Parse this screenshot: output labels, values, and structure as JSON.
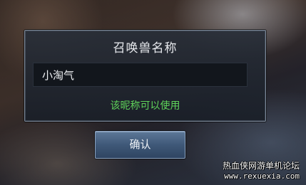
{
  "dialog": {
    "title": "召唤兽名称",
    "input_value": "小淘气",
    "status": "该昵称可以使用",
    "status_color": "#5fd35a"
  },
  "actions": {
    "confirm_label": "确认"
  },
  "watermark": {
    "title": "热血侠网游单机论坛",
    "url": "www.rexuexia.com"
  }
}
